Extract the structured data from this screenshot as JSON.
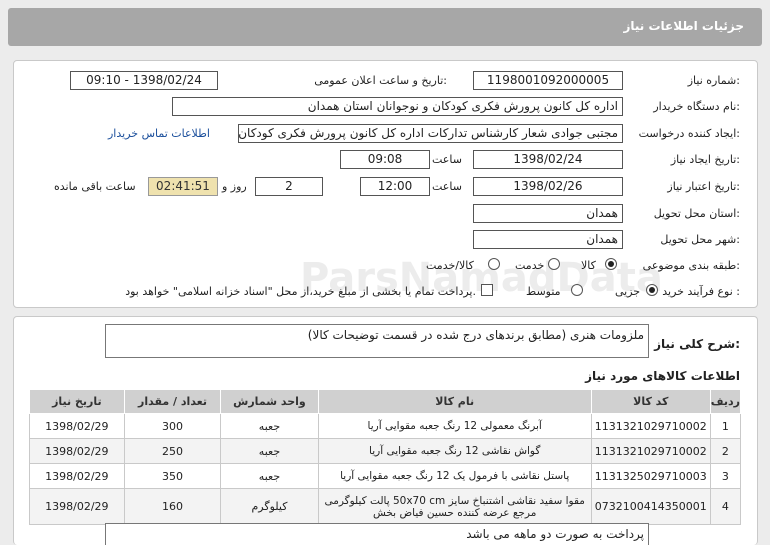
{
  "header": {
    "title": "جزئیات اطلاعات نیاز"
  },
  "need": {
    "number_label": "شماره نیاز:",
    "number_value": "1198001092000005",
    "announce_label": "تاریخ و ساعت اعلان عمومی:",
    "announce_value": "1398/02/24 - 09:10",
    "buyer_label": "نام دستگاه خریدار:",
    "buyer_value": "اداره کل کانون پرورش فکری کودکان و نوجوانان استان همدان",
    "creator_label": "ایجاد کننده درخواست:",
    "creator_value": "مجتبی جوادی شعار کارشناس تدارکات اداره کل کانون پرورش فکری کودکان و نو",
    "contact_link": "اطلاعات تماس خریدار",
    "created_label": "تاریخ ایجاد نیاز:",
    "created_date": "1398/02/24",
    "time_label": "ساعت",
    "created_time": "09:08",
    "validity_label": "تاریخ اعتبار نیاز:",
    "validity_date": "1398/02/26",
    "validity_time": "12:00",
    "days_value": "2",
    "days_label": "روز و",
    "remaining_value": "02:41:51",
    "remaining_label": "ساعت باقی مانده",
    "province_label": "استان محل تحویل:",
    "province_value": "همدان",
    "city_label": "شهر محل تحویل:",
    "city_value": "همدان",
    "category_label": "طبقه بندی موضوعی:",
    "category_options": [
      "کالا",
      "خدمت",
      "کالا/خدمت"
    ],
    "category_selected": "کالا",
    "process_label": "نوع فرآیند خرید :",
    "process_options": [
      "جزیی",
      "متوسط"
    ],
    "process_selected": "جزیی",
    "payment_text": "پرداخت تمام یا بخشی از مبلغ خرید،از محل \"اسناد خزانه اسلامی\" خواهد بود."
  },
  "summary": {
    "label": "شرح کلی نیاز:",
    "value": "ملزومات هنری (مطابق برندهای درج شده در قسمت توضیحات کالا)"
  },
  "items": {
    "title": "اطلاعات کالاهای مورد نیاز",
    "columns": [
      "ردیف",
      "کد کالا",
      "نام کالا",
      "واحد شمارش",
      "تعداد / مقدار",
      "تاریخ نیاز"
    ],
    "rows": [
      {
        "row": "1",
        "code": "1131321029710002",
        "name": "آبرنگ معمولی 12 رنگ جعبه مقوایی آریا",
        "unit": "جعبه",
        "qty": "300",
        "date": "1398/02/29"
      },
      {
        "row": "2",
        "code": "1131321029710002",
        "name": "گواش نقاشی 12 رنگ جعبه مقوایی آریا",
        "unit": "جعبه",
        "qty": "250",
        "date": "1398/02/29"
      },
      {
        "row": "3",
        "code": "1131325029710003",
        "name": "پاستل نقاشی با فرمول یک 12 رنگ جعبه مقوایی آریا",
        "unit": "جعبه",
        "qty": "350",
        "date": "1398/02/29"
      },
      {
        "row": "4",
        "code": "0732100414350001",
        "name": "مقوا سفید نقاشی اشتنباخ سایز 50x70 cm پالت کیلوگرمی مرجع عرضه کننده حسین فیاض بخش",
        "unit": "کیلوگرم",
        "qty": "160",
        "date": "1398/02/29"
      }
    ]
  },
  "note": {
    "text": "پرداخت به صورت دو ماهه می باشد"
  },
  "watermark": {
    "brand": "ParsNamadData",
    "sub": "پایگاه اطلاع رسانی مناقصه ومزایده",
    "phone": "۰۲۱-۸۸۳۴۹۶۷۰"
  }
}
